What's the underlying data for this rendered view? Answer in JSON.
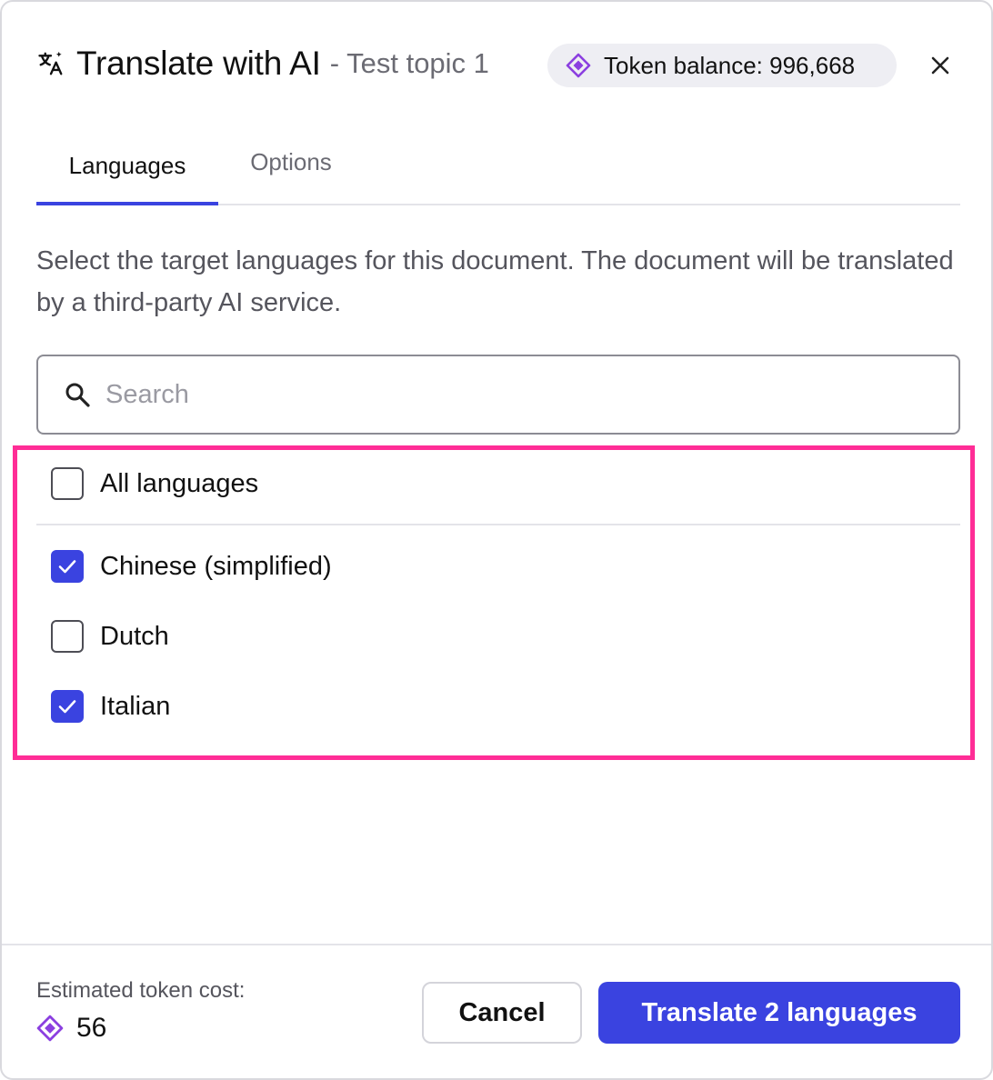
{
  "dialog": {
    "title": "Translate with AI",
    "subtitle": "- Test topic 1",
    "title_icon": "translate-icon",
    "token_balance_label": "Token balance: 996,668",
    "token_icon": "token-diamond-icon",
    "close_icon": "close-icon"
  },
  "tabs": [
    {
      "label": "Languages",
      "active": true
    },
    {
      "label": "Options",
      "active": false
    }
  ],
  "description": "Select the target languages for this document. The document will be translated by a third-party AI service.",
  "search": {
    "placeholder": "Search",
    "value": ""
  },
  "languages": {
    "all": {
      "label": "All languages",
      "checked": false
    },
    "items": [
      {
        "label": "Chinese (simplified)",
        "checked": true
      },
      {
        "label": "Dutch",
        "checked": false
      },
      {
        "label": "Italian",
        "checked": true
      }
    ]
  },
  "footer": {
    "cost_label": "Estimated token cost:",
    "cost_value": "56",
    "cancel_label": "Cancel",
    "submit_label": "Translate 2 languages"
  },
  "colors": {
    "accent": "#3a43e0",
    "token_purple": "#8b3fe0",
    "highlight": "#ff2d96"
  }
}
